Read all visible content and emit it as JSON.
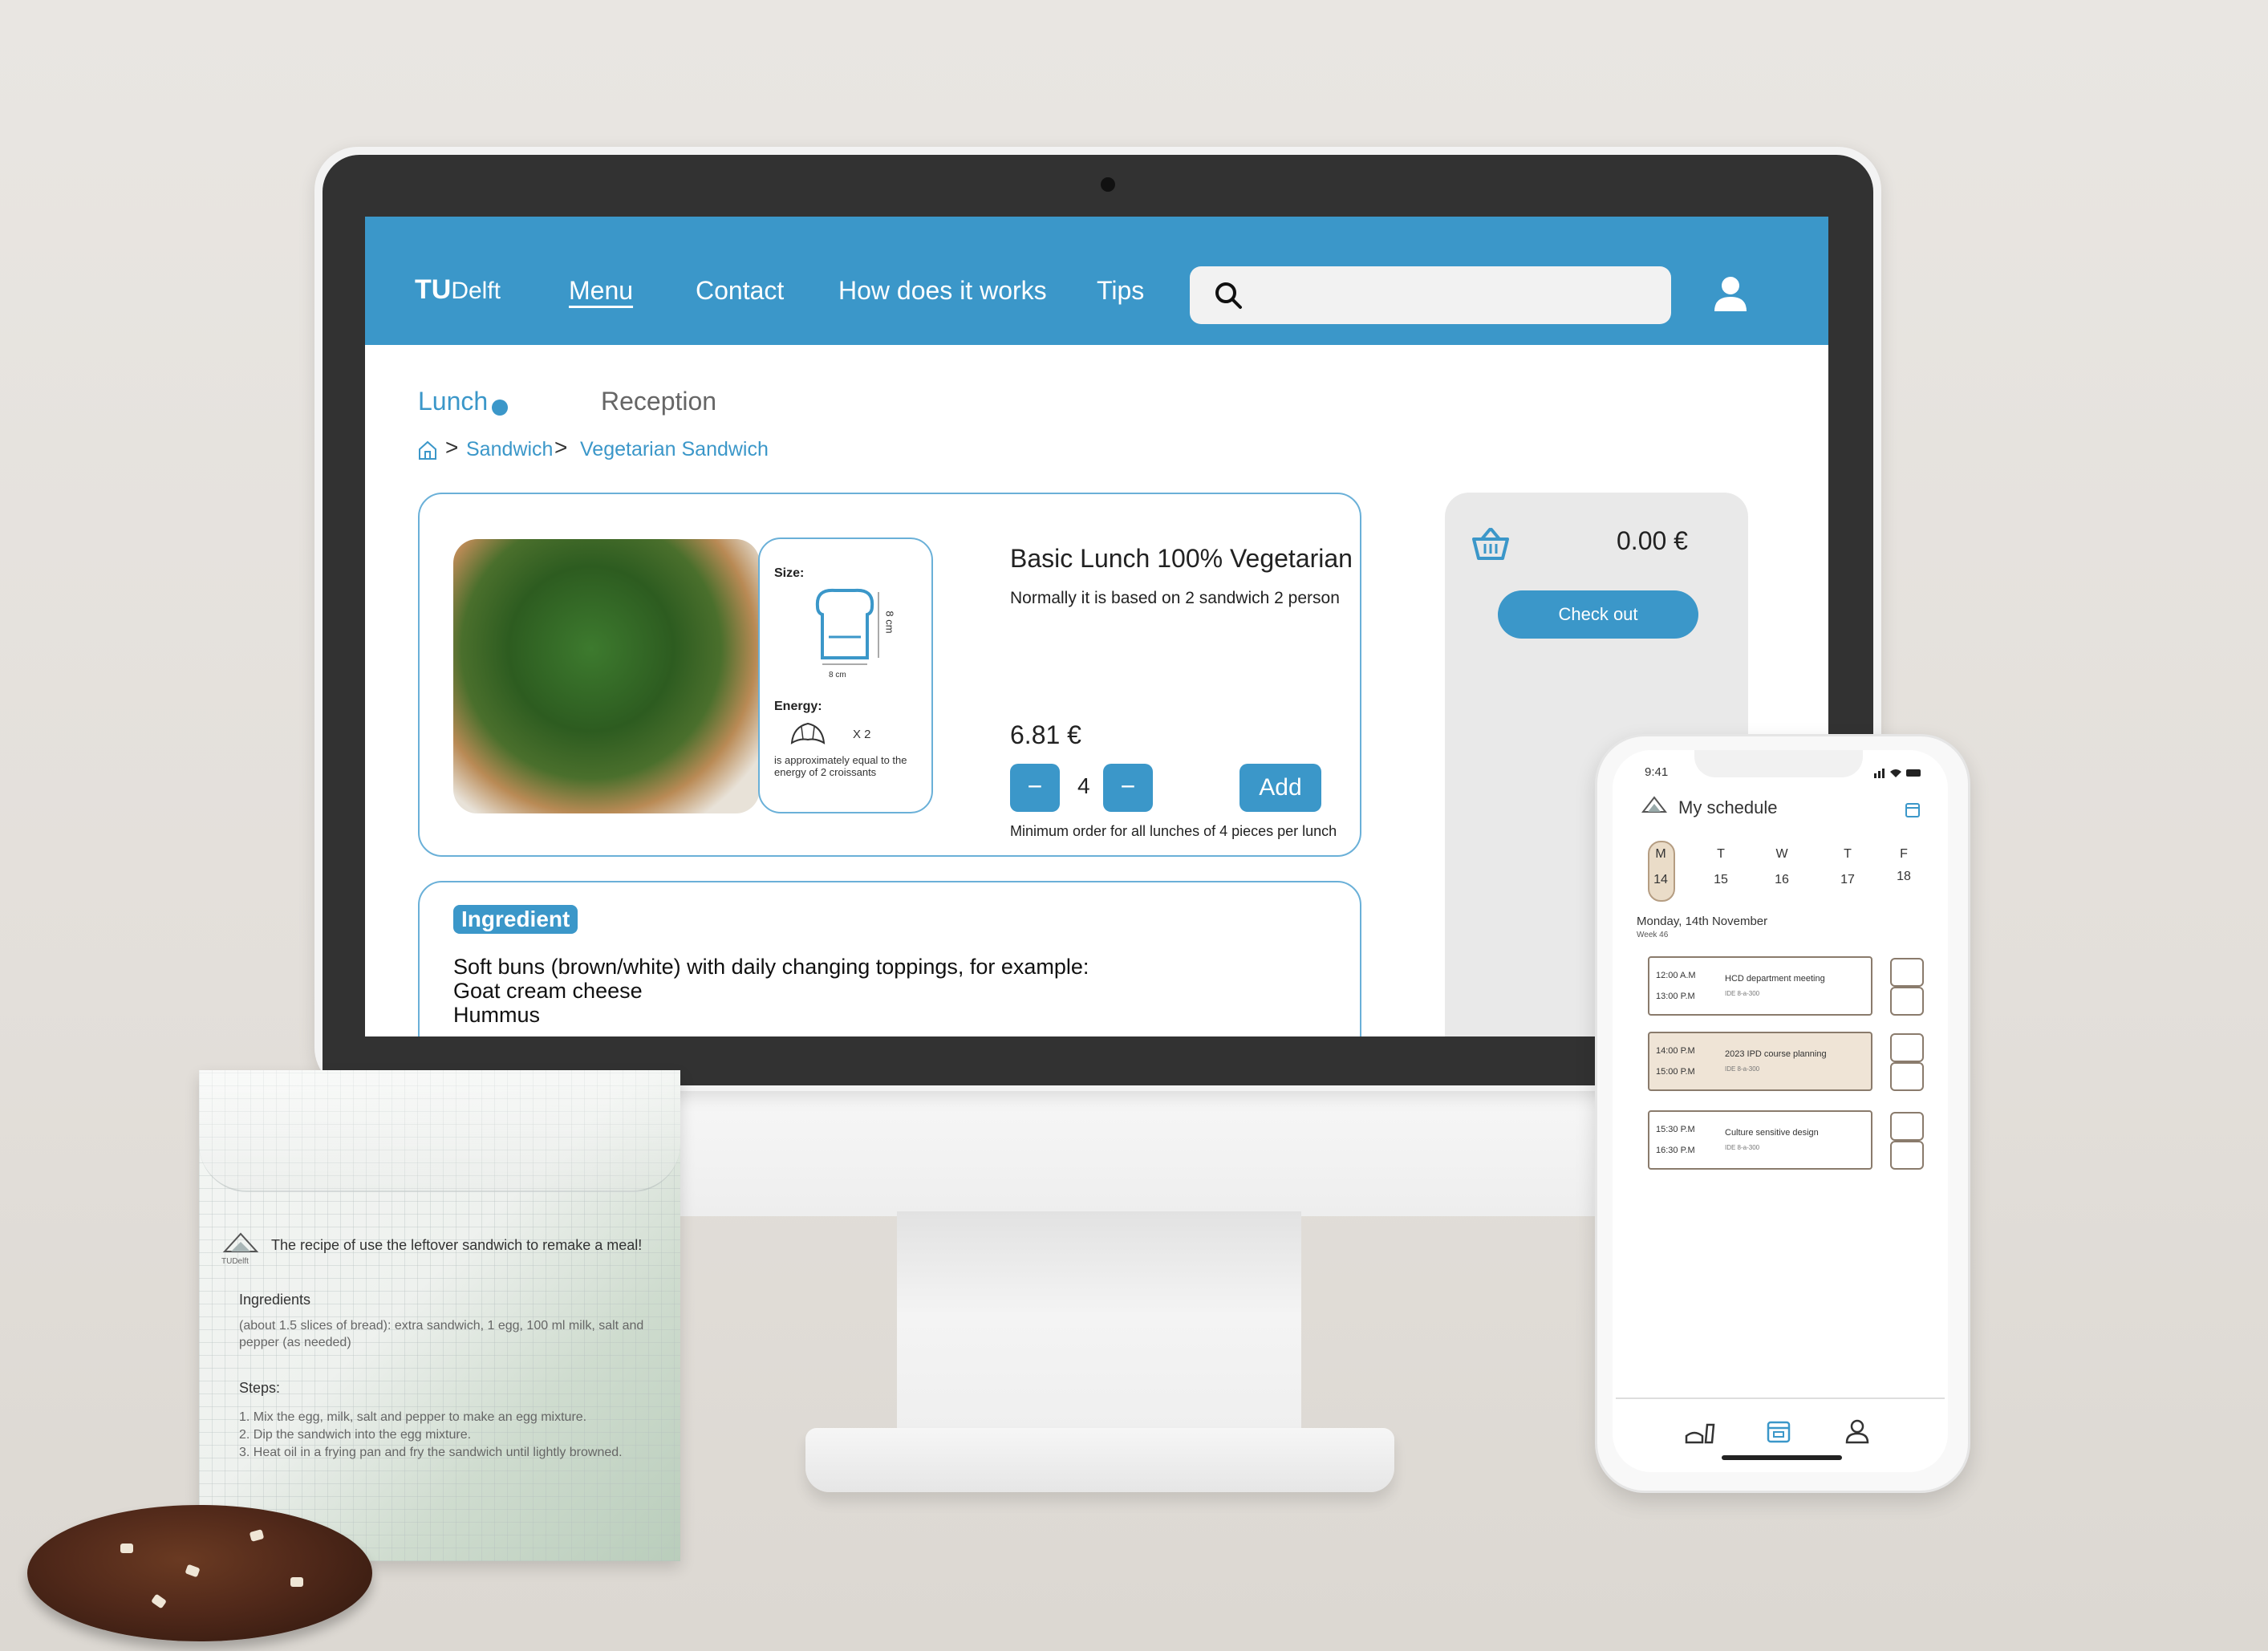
{
  "website": {
    "logo": {
      "bold": "TU",
      "light": "Delft"
    },
    "nav": [
      "Menu",
      "Contact",
      "How does it works",
      "Tips"
    ],
    "tabs": {
      "lunch": "Lunch",
      "reception": "Reception"
    },
    "breadcrumb": {
      "sep": ">",
      "level1": "Sandwich",
      "level2": "Vegetarian Sandwich"
    },
    "product": {
      "size_label": "Size:",
      "size_h": "8 cm",
      "size_w": "8 cm",
      "energy_label": "Energy:",
      "energy_mult": "X 2",
      "energy_note": "is approximately equal to the energy of 2 croissants",
      "title": "Basic Lunch 100% Vegetarian",
      "description": "Normally it is based on 2 sandwich 2 person",
      "price": "6.81 €",
      "minus": "−",
      "quantity": "4",
      "plus": "−",
      "add": "Add",
      "min_note": "Minimum order for all lunches of 4 pieces per lunch"
    },
    "ingredient": {
      "badge": "Ingredient",
      "lines": [
        "Soft buns (brown/white) with daily changing toppings, for example:",
        "Goat cream cheese",
        "Hummus"
      ]
    },
    "cart": {
      "total": "0.00 €",
      "checkout": "Check out"
    },
    "accent": "#3b97c9"
  },
  "phone": {
    "time": "9:41",
    "title": "My schedule",
    "days": [
      {
        "letter": "M",
        "num": "14"
      },
      {
        "letter": "T",
        "num": "15"
      },
      {
        "letter": "W",
        "num": "16"
      },
      {
        "letter": "T",
        "num": "17"
      },
      {
        "letter": "F",
        "num": "18"
      }
    ],
    "date": "Monday, 14th November",
    "week": "Week 46",
    "events": [
      {
        "start": "12:00 A.M",
        "end": "13:00 P.M",
        "title": "HCD department meeting",
        "loc": "IDE 8-a-300"
      },
      {
        "start": "14:00 P.M",
        "end": "15:00 P.M",
        "title": "2023 IPD course planning",
        "loc": "IDE 8-a-300"
      },
      {
        "start": "15:30 P.M",
        "end": "16:30 P.M",
        "title": "Culture sensitive design",
        "loc": "IDE 8-a-300"
      }
    ]
  },
  "bag": {
    "logo": "TUDelft",
    "title": "The recipe of use the leftover sandwich to remake a meal!",
    "ingredients_label": "Ingredients",
    "ingredients_text": "(about 1.5 slices of bread): extra sandwich, 1 egg, 100 ml milk, salt and pepper (as needed)",
    "steps_label": "Steps:",
    "steps": [
      "1. Mix the egg, milk, salt and pepper to make an egg mixture.",
      "2. Dip the sandwich into the egg mixture.",
      "3. Heat oil in a frying pan and fry the sandwich until lightly browned."
    ]
  }
}
